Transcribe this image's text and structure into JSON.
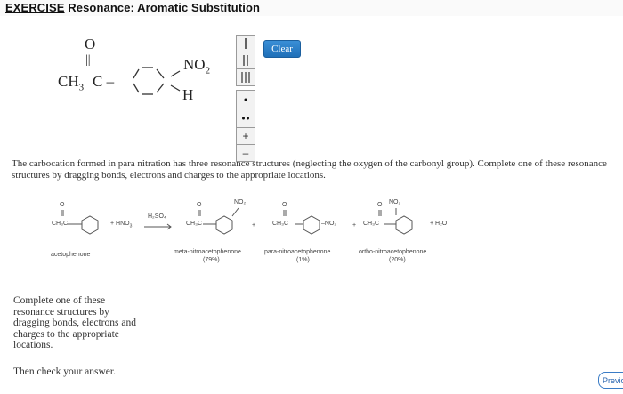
{
  "header": {
    "exercise_label": "EXERCISE",
    "title": "Resonance: Aromatic Substitution"
  },
  "canvas": {
    "oxygen": "O",
    "double_bond": "||",
    "methyl_group": "CH",
    "methyl_sub": "3",
    "carbonyl_c": "C –",
    "no2_label": "NO",
    "no2_sub": "2",
    "h_label": "H"
  },
  "toolbar": {
    "clear_label": "Clear",
    "tools": [
      "single-bond",
      "double-bond",
      "triple-bond",
      "lone-electron",
      "electron-pair",
      "plus-charge",
      "minus-charge"
    ],
    "plus_symbol": "+",
    "minus_symbol": "–"
  },
  "question_text": "The carbocation formed in para nitration has three resonance structures (neglecting the oxygen of the carbonyl group). Complete one of these resonance structures by dragging bonds, electrons and charges to the appropriate locations.",
  "scheme": {
    "acetophenone": "acetophenone",
    "reagent": "+ HNO",
    "reagent_sub": "3",
    "catalyst": "H₂SO₄",
    "meta_name": "meta-nitroacetophenone",
    "meta_yield": "(79%)",
    "para_name": "para-nitroacetophenone",
    "para_yield": "(1%)",
    "ortho_name": "ortho-nitroacetophenone",
    "ortho_yield": "(20%)",
    "water": "+ H₂O",
    "ch3c": "CH₃C",
    "o_label": "O",
    "no2": "NO₂",
    "no2_dash": "–NO₂"
  },
  "instructions": "Complete one of these resonance structures by dragging bonds, electrons and charges to the appropriate locations.",
  "check_text": "Then check your answer.",
  "nav": {
    "previous_label": "Previous"
  }
}
